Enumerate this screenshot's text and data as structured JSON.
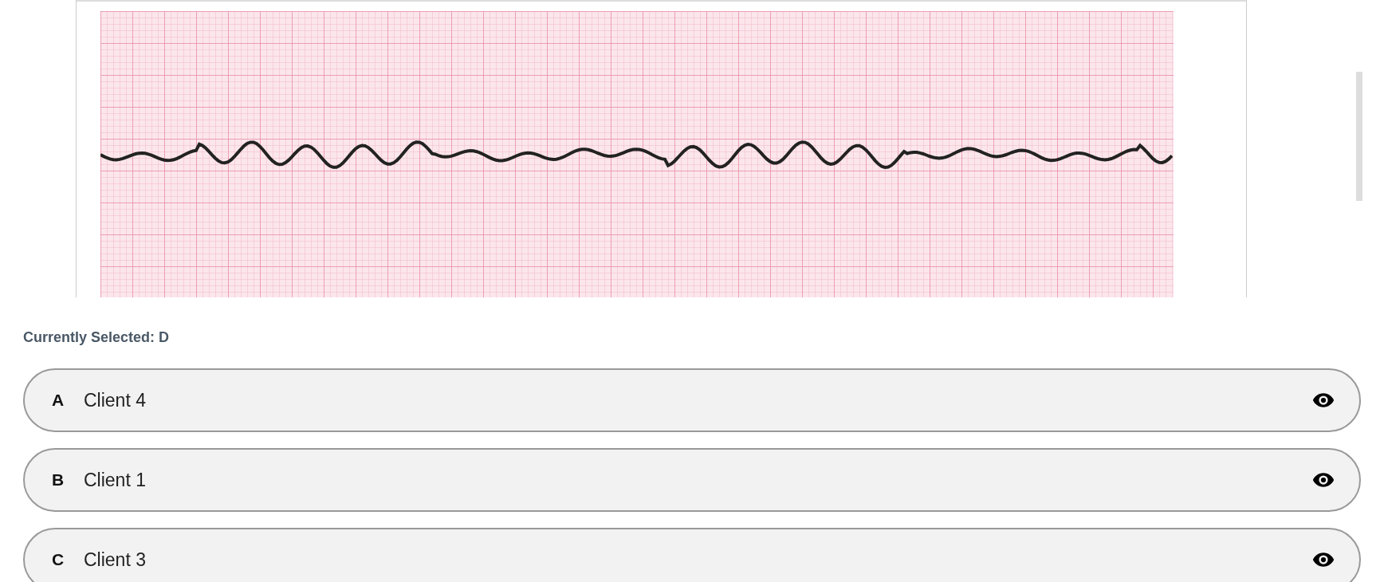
{
  "selection_label": "Currently Selected: D",
  "options": [
    {
      "letter": "A",
      "label": "Client 4"
    },
    {
      "letter": "B",
      "label": "Client 1"
    },
    {
      "letter": "C",
      "label": "Client 3"
    }
  ]
}
